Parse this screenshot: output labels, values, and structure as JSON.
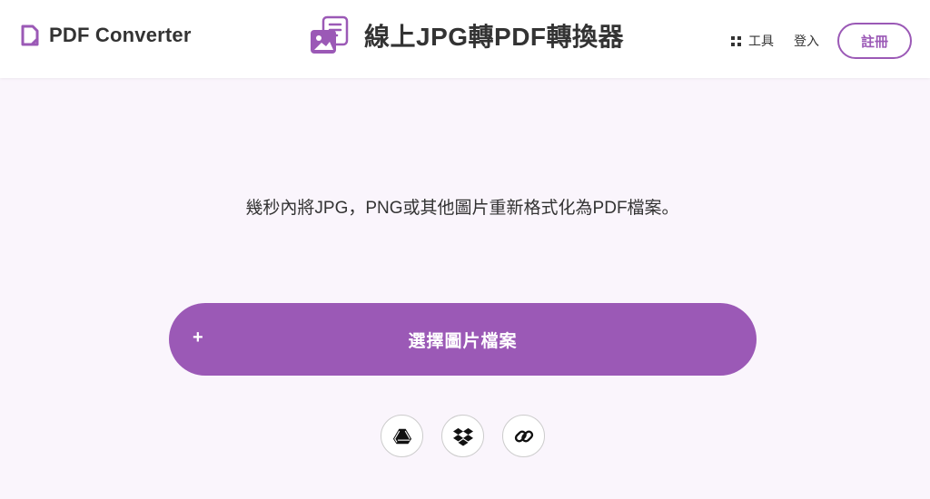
{
  "header": {
    "logo_text": "PDF Converter",
    "title": "線上JPG轉PDF轉換器",
    "tools_label": "工具",
    "login_label": "登入",
    "signup_label": "註冊"
  },
  "main": {
    "subtitle": "幾秒內將JPG，PNG或其他圖片重新格式化為PDF檔案。",
    "upload_plus": "+",
    "upload_label": "選擇圖片檔案"
  },
  "colors": {
    "accent": "#9b59b6",
    "page_bg": "#faf5fc",
    "text": "#333333"
  },
  "icons": {
    "logo": "pdf-document-icon",
    "title": "image-document-icon",
    "tools": "grid-icon",
    "cloud": [
      "google-drive-icon",
      "dropbox-icon",
      "link-icon"
    ]
  }
}
